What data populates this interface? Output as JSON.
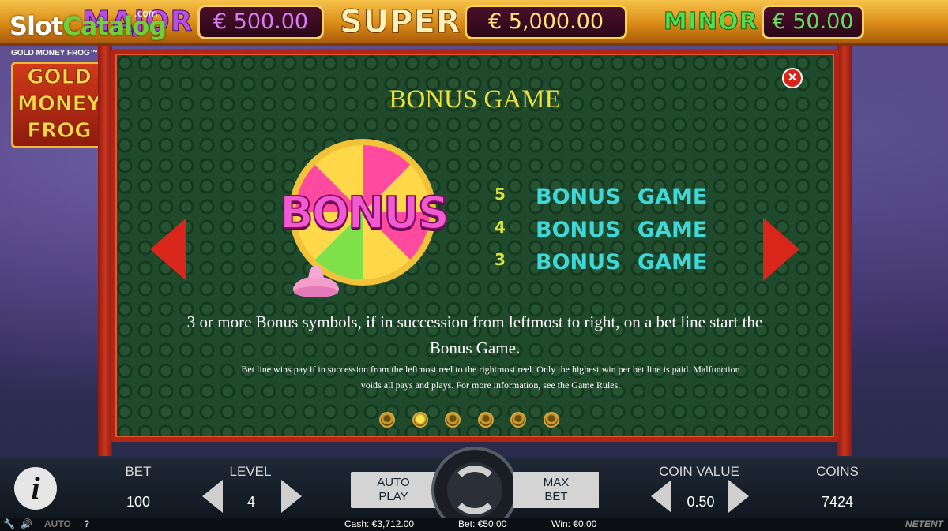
{
  "jackpots": {
    "major": {
      "label": "MAJOR",
      "value": "€ 500.00"
    },
    "super": {
      "label": "SUPER",
      "value": "€ 5,000.00"
    },
    "minor": {
      "label": "MINOR",
      "value": "€ 50.00"
    }
  },
  "watermark": {
    "part1": "Slot",
    "part2": "Catalog",
    "tld": ".com"
  },
  "logo": {
    "subtitle": "GOLD MONEY FROG™",
    "lines": [
      "GOLD",
      "MONEY",
      "FROG"
    ]
  },
  "paytable": {
    "title": "BONUS GAME",
    "symbol_text": "BONUS",
    "close_label": "✕",
    "payouts": [
      {
        "count": "5",
        "prize": "BONUS GAME"
      },
      {
        "count": "4",
        "prize": "BONUS GAME"
      },
      {
        "count": "3",
        "prize": "BONUS GAME"
      }
    ],
    "rule": "3 or more Bonus symbols, if in succession from leftmost to right, on a bet line start the Bonus Game.",
    "fine_print": "Bet line wins pay if in succession from the leftmost reel to the rightmost reel. Only the highest win per bet line is paid. Malfunction voids all pays and plays. For more information, see the Game Rules.",
    "page_count": 6,
    "active_page": 2
  },
  "controls": {
    "info_label": "i",
    "bet": {
      "label": "BET",
      "value": "100"
    },
    "level": {
      "label": "LEVEL",
      "value": "4"
    },
    "autoplay_label_1": "AUTO",
    "autoplay_label_2": "PLAY",
    "maxbet_label_1": "MAX",
    "maxbet_label_2": "BET",
    "coin_value": {
      "label": "COIN VALUE",
      "value": "0.50"
    },
    "coins": {
      "label": "COINS",
      "value": "7424"
    }
  },
  "status_bar": {
    "auto_label": "AUTO",
    "help_label": "?",
    "cash": "Cash: €3,712.00",
    "bet": "Bet: €50.00",
    "win": "Win: €0.00",
    "brand": "NETENT"
  },
  "colors": {
    "panel_bg": "#1f4a2c",
    "panel_border": "#b32616",
    "title": "#f1e23a",
    "payout_count": "#d8e43a",
    "payout_prize": "#3fd8d8"
  }
}
